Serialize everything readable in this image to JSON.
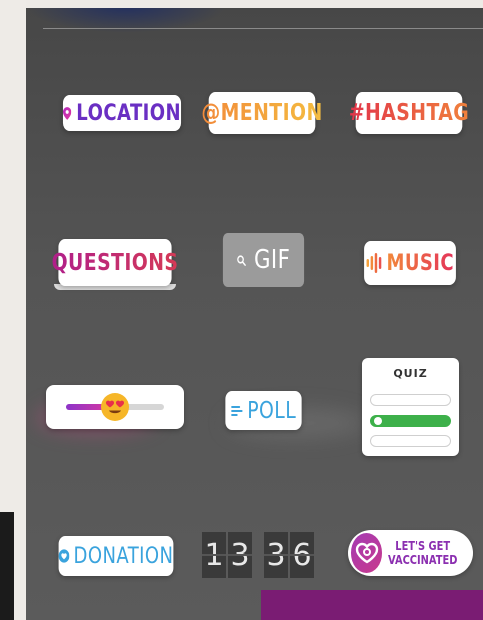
{
  "stickers": {
    "location": {
      "label": "LOCATION",
      "icon": "location-pin-icon"
    },
    "mention": {
      "label": "@MENTION"
    },
    "hashtag": {
      "label": "#HASHTAG"
    },
    "questions": {
      "label": "QUESTIONS"
    },
    "gif": {
      "label": "GIF",
      "icon": "search-icon"
    },
    "music": {
      "label": "MUSIC",
      "icon": "music-bars-icon"
    },
    "emoji_slider": {
      "emoji": "heart-eyes-emoji",
      "level": 0.5
    },
    "poll": {
      "label": "POLL",
      "icon": "poll-lines-icon"
    },
    "quiz": {
      "label": "QUIZ",
      "options": 3,
      "selected_option": 2
    },
    "donation": {
      "label": "DONATION",
      "icon": "heart-icon"
    },
    "countdown": {
      "digits": [
        "1",
        "3",
        "3",
        "6"
      ]
    },
    "vaccinated": {
      "line1": "LET'S GET",
      "line2": "VACCINATED",
      "icon": "heart-badge-icon"
    }
  },
  "colors": {
    "panel": "#555555",
    "location": "#6a2fc3",
    "poll": "#3aa3dd",
    "quiz_selected": "#3db04a",
    "vaccinated": "#8b2fb0",
    "accent_bar": "#7a1c73"
  }
}
